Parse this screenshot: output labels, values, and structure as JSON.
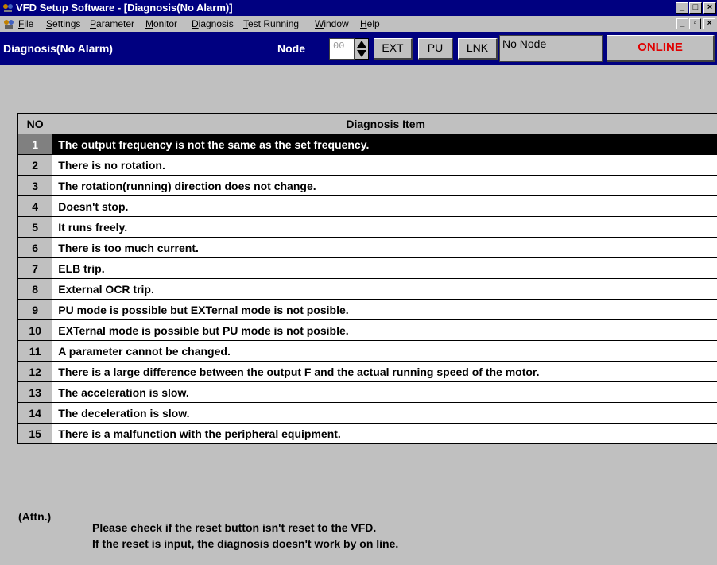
{
  "window": {
    "title": "VFD Setup Software - [Diagnosis(No Alarm)]",
    "minimize": "_",
    "maximize": "□",
    "close": "×"
  },
  "menu": {
    "items": [
      "File",
      "Settings",
      "Parameter",
      "Monitor",
      "Diagnosis",
      "Test Running",
      "Window",
      "Help"
    ],
    "mdi_minimize": "_",
    "mdi_restore": "▫",
    "mdi_close": "×"
  },
  "toolbar": {
    "screen_label": "Diagnosis(No Alarm)",
    "node_label": "Node",
    "node_value": "00",
    "ext_label": "EXT",
    "pu_label": "PU",
    "lnk_label": "LNK",
    "node_status": "No Node",
    "online_first": "O",
    "online_rest": "NLINE",
    "online_color": "#e00000"
  },
  "table": {
    "col_no": "NO",
    "col_item": "Diagnosis Item",
    "selected_row": 1,
    "rows": [
      {
        "no": "1",
        "item": "The output frequency is not the same as the set frequency."
      },
      {
        "no": "2",
        "item": "There is no rotation."
      },
      {
        "no": "3",
        "item": "The rotation(running) direction does not change."
      },
      {
        "no": "4",
        "item": "Doesn't stop."
      },
      {
        "no": "5",
        "item": "It runs freely."
      },
      {
        "no": "6",
        "item": "There is too much current."
      },
      {
        "no": "7",
        "item": "ELB trip."
      },
      {
        "no": "8",
        "item": "External OCR trip."
      },
      {
        "no": "9",
        "item": "PU mode is possible but EXTernal mode is not posible."
      },
      {
        "no": "10",
        "item": "EXTernal mode is possible but PU mode is not posible."
      },
      {
        "no": "11",
        "item": "A parameter cannot be changed."
      },
      {
        "no": "12",
        "item": "There is a large difference between the output F and the actual running speed of the motor."
      },
      {
        "no": "13",
        "item": "The acceleration is slow."
      },
      {
        "no": "14",
        "item": "The deceleration is slow."
      },
      {
        "no": "15",
        "item": "There is a malfunction with the peripheral equipment."
      }
    ]
  },
  "note": {
    "label": "(Attn.)",
    "line1": "Please check if the reset button isn't reset to the VFD.",
    "line2": "If the reset is input, the diagnosis doesn't work by on line."
  }
}
